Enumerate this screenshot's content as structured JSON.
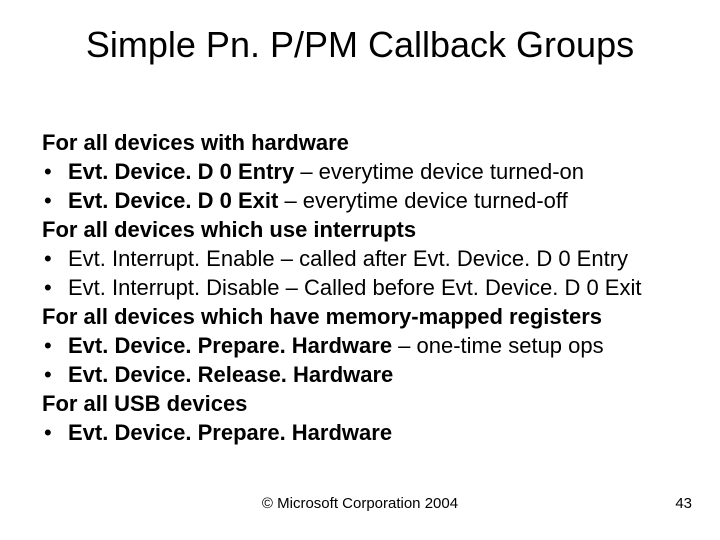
{
  "title": "Simple Pn. P/PM Callback Groups",
  "sections": [
    {
      "heading": "For all devices with hardware",
      "bullets": [
        {
          "bold": "Evt. Device. D 0 Entry",
          "rest": " – everytime device turned-on"
        },
        {
          "bold": "Evt. Device. D 0 Exit",
          "rest": " – everytime device turned-off"
        }
      ]
    },
    {
      "heading": "For all devices which use interrupts",
      "bullets": [
        {
          "bold": "",
          "rest": "Evt. Interrupt. Enable – called after Evt. Device. D 0 Entry"
        },
        {
          "bold": "",
          "rest": "Evt. Interrupt. Disable – Called before Evt. Device. D 0 Exit"
        }
      ]
    },
    {
      "heading": "For all devices which have memory-mapped registers",
      "bullets": [
        {
          "bold": "Evt. Device. Prepare. Hardware",
          "rest": " – one-time setup ops"
        },
        {
          "bold": "Evt. Device. Release. Hardware",
          "rest": ""
        }
      ]
    },
    {
      "heading": "For all USB devices",
      "bullets": [
        {
          "bold": "Evt. Device. Prepare. Hardware",
          "rest": ""
        }
      ]
    }
  ],
  "footer": "© Microsoft Corporation 2004",
  "pagenum": "43",
  "bullet_glyph": "•"
}
